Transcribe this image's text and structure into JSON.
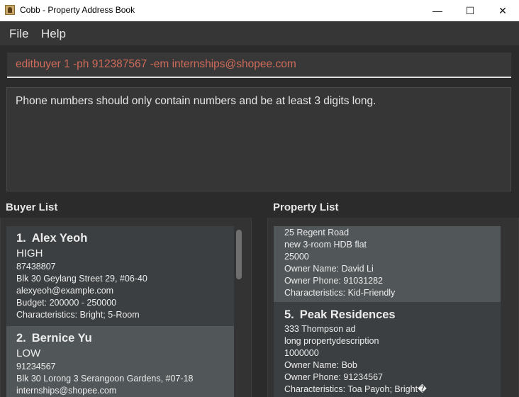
{
  "window": {
    "title": "Cobb - Property Address Book",
    "controls": {
      "minimize": "—",
      "maximize": "☐",
      "close": "✕"
    }
  },
  "menu": {
    "file": "File",
    "help": "Help"
  },
  "command_box": {
    "value": "editbuyer 1 -ph 912387567 -em internships@shopee.com"
  },
  "result_box": {
    "message": "Phone numbers should only contain numbers and be at least 3 digits long."
  },
  "buyer_list": {
    "label": "Buyer List",
    "items": [
      {
        "index": "1.",
        "name": "Alex Yeoh",
        "priority": "HIGH",
        "phone": "87438807",
        "address": "Blk 30 Geylang Street 29, #06-40",
        "email": "alexyeoh@example.com",
        "budget": "Budget: 200000 - 250000",
        "characteristics": "Characteristics: Bright; 5-Room"
      },
      {
        "index": "2.",
        "name": "Bernice Yu",
        "priority": "LOW",
        "phone": "91234567",
        "address": "Blk 30 Lorong 3 Serangoon Gardens, #07-18",
        "email": "internships@shopee.com"
      }
    ]
  },
  "property_list": {
    "label": "Property List",
    "items": [
      {
        "address": "25 Regent Road",
        "description": "new 3-room HDB flat",
        "price": "25000",
        "owner_name": "Owner Name: David Li",
        "owner_phone": "Owner Phone: 91031282",
        "characteristics": "Characteristics: Kid-Friendly"
      },
      {
        "index": "5.",
        "name": "Peak Residences",
        "address": "333 Thompson ad",
        "description": "long propertydescription",
        "price": "1000000",
        "owner_name": "Owner Name: Bob",
        "owner_phone": "Owner Phone: 91234567",
        "characteristics": "Characteristics: Toa Payoh; Bright�"
      }
    ]
  },
  "colors": {
    "background": "#2b2b2b",
    "command_text": "#d06b5b",
    "card_selected": "#515658",
    "card_normal": "#3b3f41"
  }
}
